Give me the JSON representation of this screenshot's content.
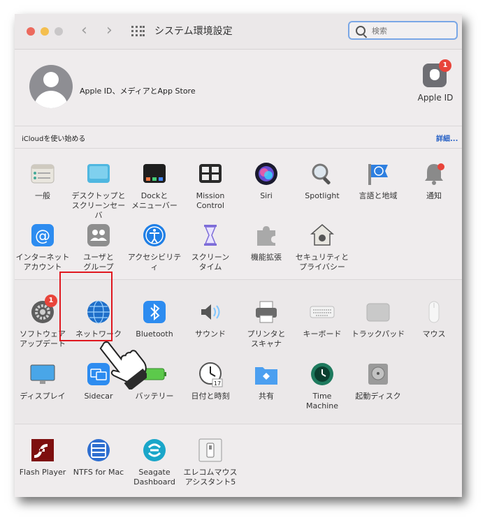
{
  "window": {
    "title": "システム環境設定"
  },
  "search": {
    "placeholder": "検索"
  },
  "account": {
    "label": "Apple ID、メディアとApp Store",
    "apple_id_label": "Apple ID",
    "apple_id_badge": "1"
  },
  "icloud": {
    "text": "iCloudを使い始める",
    "details": "詳細..."
  },
  "section1": [
    {
      "label": "一般",
      "icon": "general-icon"
    },
    {
      "label": "デスクトップと\nスクリーンセーバ",
      "icon": "desktop-icon"
    },
    {
      "label": "Dockと\nメニューバー",
      "icon": "dock-icon"
    },
    {
      "label": "Mission\nControl",
      "icon": "mission-control-icon"
    },
    {
      "label": "Siri",
      "icon": "siri-icon"
    },
    {
      "label": "Spotlight",
      "icon": "spotlight-icon"
    },
    {
      "label": "言語と地域",
      "icon": "language-icon"
    },
    {
      "label": "通知",
      "icon": "notification-icon"
    },
    {
      "label": "インターネット\nアカウント",
      "icon": "internet-accounts-icon"
    },
    {
      "label": "ユーザと\nグループ",
      "icon": "users-icon"
    },
    {
      "label": "アクセシビリティ",
      "icon": "accessibility-icon"
    },
    {
      "label": "スクリーン\nタイム",
      "icon": "screen-time-icon"
    },
    {
      "label": "機能拡張",
      "icon": "extensions-icon"
    },
    {
      "label": "セキュリティと\nプライバシー",
      "icon": "security-icon"
    }
  ],
  "section2": [
    {
      "label": "ソフトウェア\nアップデート",
      "icon": "software-update-icon",
      "badge": "1"
    },
    {
      "label": "ネットワーク",
      "icon": "network-icon"
    },
    {
      "label": "Bluetooth",
      "icon": "bluetooth-icon"
    },
    {
      "label": "サウンド",
      "icon": "sound-icon"
    },
    {
      "label": "プリンタと\nスキャナ",
      "icon": "printer-icon"
    },
    {
      "label": "キーボード",
      "icon": "keyboard-icon"
    },
    {
      "label": "トラックパッド",
      "icon": "trackpad-icon"
    },
    {
      "label": "マウス",
      "icon": "mouse-icon"
    },
    {
      "label": "ディスプレイ",
      "icon": "display-icon"
    },
    {
      "label": "Sidecar",
      "icon": "sidecar-icon"
    },
    {
      "label": "バッテリー",
      "icon": "battery-icon"
    },
    {
      "label": "日付と時刻",
      "icon": "clock-icon"
    },
    {
      "label": "共有",
      "icon": "sharing-icon"
    },
    {
      "label": "Time\nMachine",
      "icon": "time-machine-icon"
    },
    {
      "label": "起動ディスク",
      "icon": "startup-disk-icon"
    }
  ],
  "section3": [
    {
      "label": "Flash Player",
      "icon": "flash-player-icon"
    },
    {
      "label": "NTFS for Mac",
      "icon": "ntfs-icon"
    },
    {
      "label": "Seagate\nDashboard",
      "icon": "seagate-icon"
    },
    {
      "label": "エレコムマウス\nアシスタント5",
      "icon": "elecom-icon"
    }
  ],
  "colors": {
    "highlight": "#e0171f",
    "accent": "#2a63c6",
    "badge": "#e8443a"
  }
}
